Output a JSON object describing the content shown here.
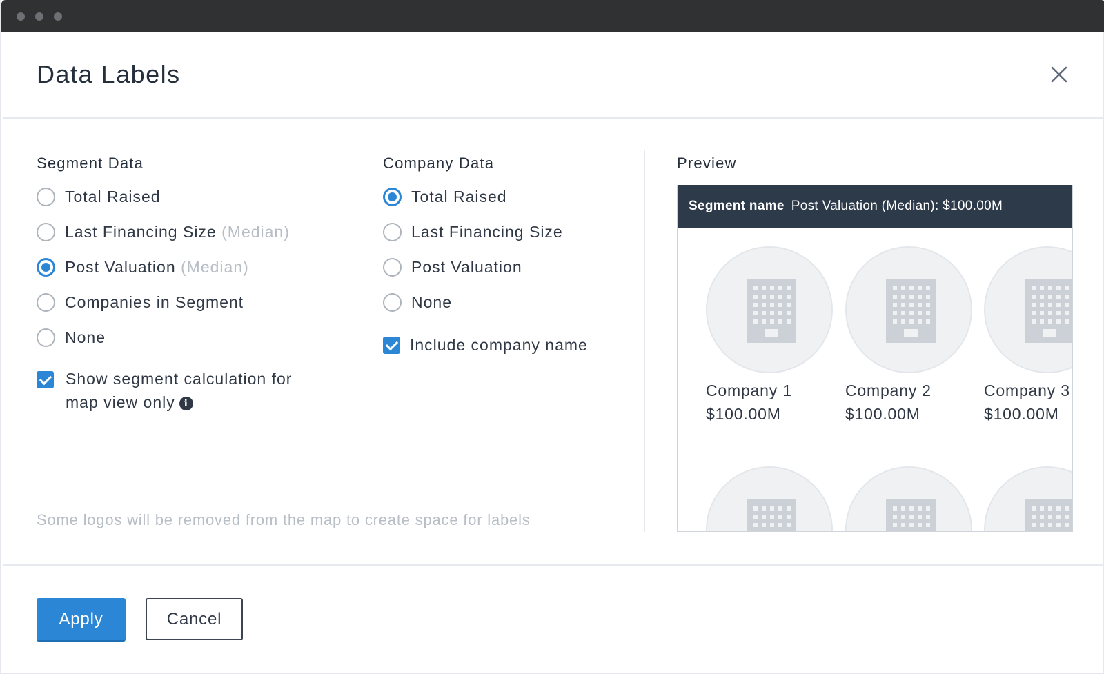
{
  "dialog": {
    "title": "Data Labels",
    "close_icon": "close-icon"
  },
  "segment": {
    "title": "Segment Data",
    "options": [
      {
        "label": "Total Raised",
        "suffix": "",
        "checked": false
      },
      {
        "label": "Last Financing Size",
        "suffix": "(Median)",
        "checked": false
      },
      {
        "label": "Post Valuation",
        "suffix": "(Median)",
        "checked": true
      },
      {
        "label": "Companies in Segment",
        "suffix": "",
        "checked": false
      },
      {
        "label": "None",
        "suffix": "",
        "checked": false
      }
    ],
    "checkbox": {
      "line1": "Show segment calculation for",
      "line2": "map view only",
      "checked": true,
      "icon": "info-icon"
    }
  },
  "company": {
    "title": "Company Data",
    "options": [
      {
        "label": "Total Raised",
        "checked": true
      },
      {
        "label": "Last Financing Size",
        "checked": false
      },
      {
        "label": "Post Valuation",
        "checked": false
      },
      {
        "label": "None",
        "checked": false
      }
    ],
    "checkbox": {
      "label": "Include company name",
      "checked": true
    }
  },
  "note": "Some logos will be removed from the map to create space for labels",
  "preview": {
    "title": "Preview",
    "bar_segment": "Segment name",
    "bar_value": "Post Valuation (Median): $100.00M",
    "companies": [
      {
        "name": "Company 1",
        "value": "$100.00M"
      },
      {
        "name": "Company 2",
        "value": "$100.00M"
      },
      {
        "name": "Company 3",
        "value": "$100.00M"
      }
    ],
    "logo_icon": "building-icon"
  },
  "footer": {
    "apply_label": "Apply",
    "cancel_label": "Cancel"
  },
  "colors": {
    "accent": "#2b86d6",
    "preview_header": "#2d3a4a",
    "window_chrome": "#2f3133"
  }
}
